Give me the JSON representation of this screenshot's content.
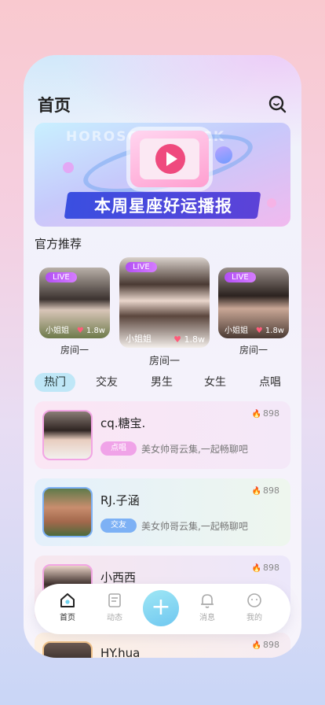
{
  "header": {
    "title": "首页"
  },
  "banner": {
    "bg_text": "HOROSCOPE LUCK",
    "title": "本周星座好运播报"
  },
  "recommend": {
    "title": "官方推荐",
    "cards": [
      {
        "live": "LIVE",
        "name": "小姐姐",
        "heat": "1.8w",
        "room": "房间一"
      },
      {
        "live": "LIVE",
        "name": "小姐姐",
        "heat": "1.8w",
        "room": "房间一"
      },
      {
        "live": "LIVE",
        "name": "小姐姐",
        "heat": "1.8w",
        "room": "房间一"
      }
    ]
  },
  "tabs": [
    "热门",
    "交友",
    "男生",
    "女生",
    "点唱"
  ],
  "users": [
    {
      "name": "cq.糖宝.",
      "tag": "点唱",
      "desc": "美女帅哥云集,一起畅聊吧",
      "heat": "898",
      "tag_color": "#f0a3e8"
    },
    {
      "name": "RJ.子涵",
      "tag": "交友",
      "desc": "美女帅哥云集,一起畅聊吧",
      "heat": "898",
      "tag_color": "#7db1f5"
    },
    {
      "name": "小西西",
      "tag": "",
      "desc": "",
      "heat": "898",
      "tag_color": ""
    },
    {
      "name": "HY.hua",
      "tag": "",
      "desc": "",
      "heat": "898",
      "tag_color": ""
    }
  ],
  "tabbar": {
    "home": "首页",
    "feed": "动态",
    "plus": "+",
    "messages": "消息",
    "mine": "我的"
  }
}
